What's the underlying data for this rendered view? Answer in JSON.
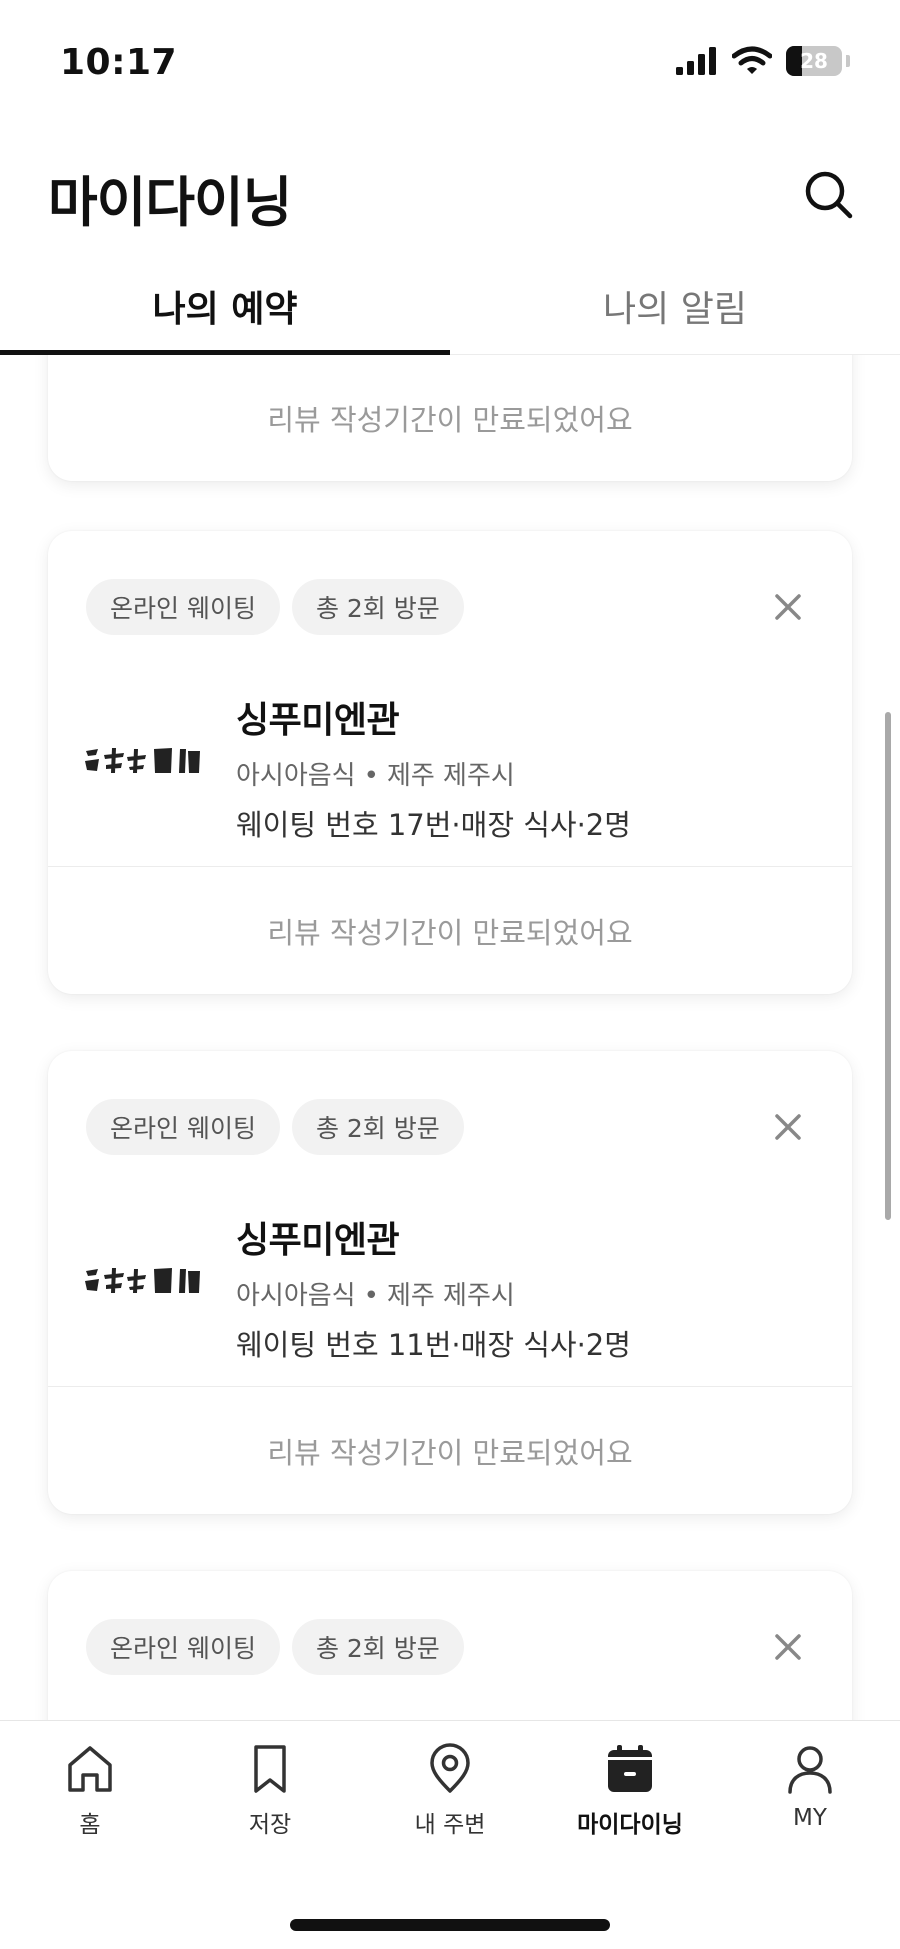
{
  "status_bar": {
    "time": "10:17",
    "battery_level": "28",
    "battery_fraction": 0.28
  },
  "header": {
    "title": "마이다이닝",
    "tabs": [
      {
        "label": "나의 예약",
        "active": true
      },
      {
        "label": "나의 알림",
        "active": false
      }
    ]
  },
  "reservations": [
    {
      "footer": "리뷰 작성기간이 만료되었어요"
    },
    {
      "chips": [
        "온라인 웨이팅",
        "총 2회 방문"
      ],
      "name": "싱푸미엔관",
      "category": "아시아음식",
      "location": "제주 제주시",
      "detail": "웨이팅 번호 17번·매장 식사·2명",
      "footer": "리뷰 작성기간이 만료되었어요"
    },
    {
      "chips": [
        "온라인 웨이팅",
        "총 2회 방문"
      ],
      "name": "싱푸미엔관",
      "category": "아시아음식",
      "location": "제주 제주시",
      "detail": "웨이팅 번호 11번·매장 식사·2명",
      "footer": "리뷰 작성기간이 만료되었어요"
    },
    {
      "chips": [
        "온라인 웨이팅",
        "총 2회 방문"
      ]
    }
  ],
  "bottom_nav": [
    {
      "label": "홈",
      "icon": "home-icon",
      "active": false
    },
    {
      "label": "저장",
      "icon": "bookmark-icon",
      "active": false
    },
    {
      "label": "내 주변",
      "icon": "location-pin-icon",
      "active": false
    },
    {
      "label": "마이다이닝",
      "icon": "calendar-icon",
      "active": true
    },
    {
      "label": "MY",
      "icon": "person-icon",
      "active": false
    }
  ],
  "colors": {
    "text_primary": "#111111",
    "text_secondary": "#666666",
    "text_muted": "#9a9a9a",
    "chip_bg": "#f2f2f2"
  }
}
